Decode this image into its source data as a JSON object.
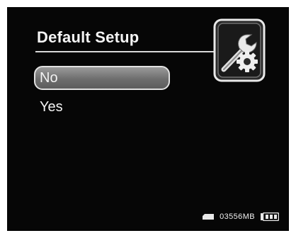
{
  "menu": {
    "title": "Default Setup",
    "options": [
      {
        "label": "No",
        "selected": true
      },
      {
        "label": "Yes",
        "selected": false
      }
    ]
  },
  "status": {
    "storage_remaining": "03556MB",
    "storage_icon": "memory-card-icon",
    "battery_icon": "battery-icon",
    "battery_bars": 3
  },
  "icons": {
    "setup": "wrench-gear-icon"
  },
  "colors": {
    "background": "#060606",
    "text": "#f2f2f2",
    "selection_fill": "#7a7a7a",
    "selection_border": "#e2e2e2"
  }
}
